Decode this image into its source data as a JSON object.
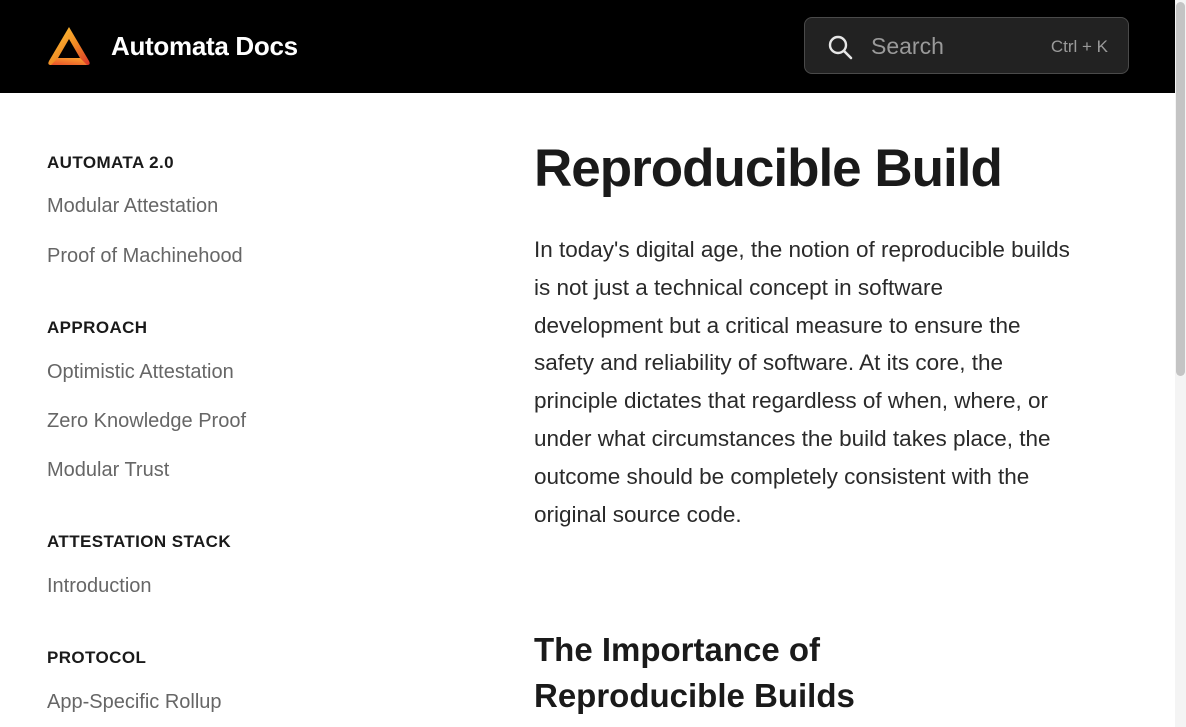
{
  "header": {
    "brand": "Automata Docs",
    "search": {
      "placeholder": "Search",
      "shortcut": "Ctrl + K"
    }
  },
  "sidebar": {
    "sections": [
      {
        "heading": "AUTOMATA 2.0",
        "items": [
          "Modular Attestation",
          "Proof of Machinehood"
        ]
      },
      {
        "heading": "APPROACH",
        "items": [
          "Optimistic Attestation",
          "Zero Knowledge Proof",
          "Modular Trust"
        ]
      },
      {
        "heading": "ATTESTATION STACK",
        "items": [
          "Introduction"
        ]
      },
      {
        "heading": "PROTOCOL",
        "items": [
          "App-Specific Rollup"
        ]
      }
    ]
  },
  "content": {
    "title": "Reproducible Build",
    "intro": "In today's digital age, the notion of reproducible builds is not just a technical concept in software development but a critical measure to ensure the safety and reliability of software. At its core, the principle dictates that regardless of when, where, or under what circumstances the build takes place, the outcome should be completely consistent with the original source code.",
    "section_title": "The Importance of Reproducible Builds"
  },
  "colors": {
    "header_bg": "#000000",
    "logo_orange": "#f5a623",
    "logo_red": "#e8432a"
  }
}
